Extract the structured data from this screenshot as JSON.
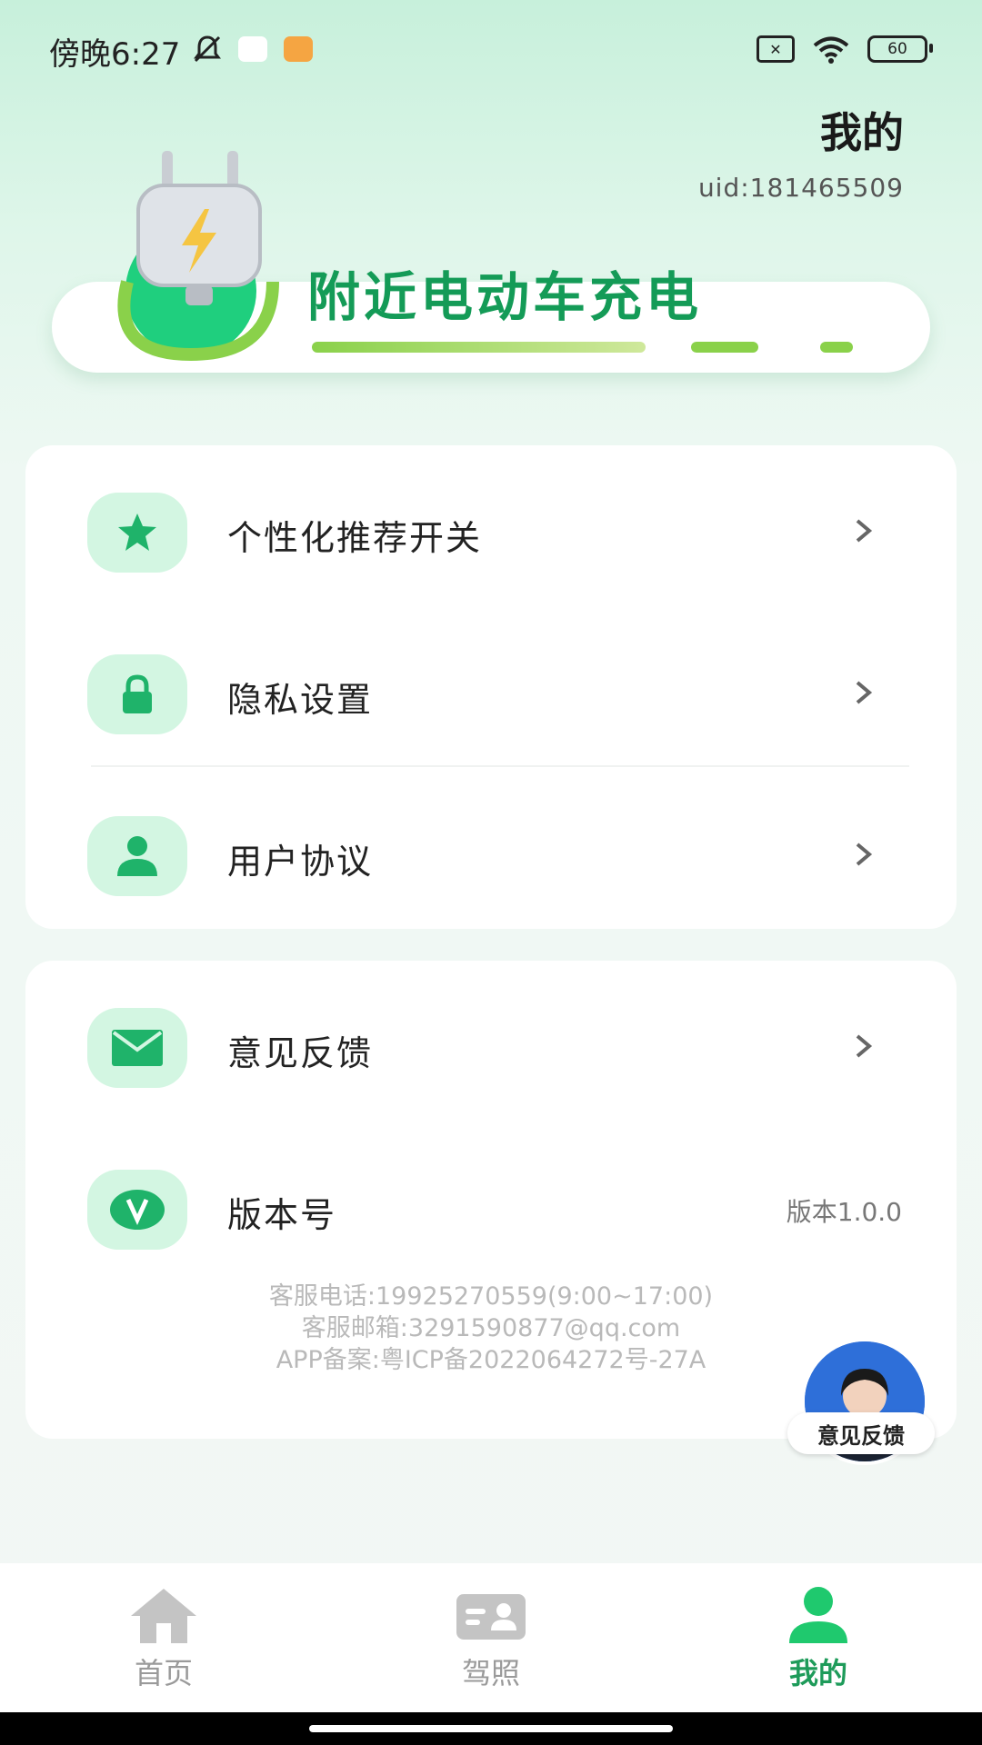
{
  "status_bar": {
    "time": "傍晚6:27",
    "battery": "60"
  },
  "header": {
    "title": "我的",
    "uid": "uid:181465509"
  },
  "banner": {
    "text": "附近电动车充电"
  },
  "menu_card_1": {
    "items": [
      {
        "label": "个性化推荐开关",
        "icon": "star-icon"
      },
      {
        "label": "隐私设置",
        "icon": "lock-icon"
      },
      {
        "label": "用户协议",
        "icon": "user-icon"
      }
    ]
  },
  "menu_card_2": {
    "feedback_label": "意见反馈",
    "version_label": "版本号",
    "version_value": "版本1.0.0"
  },
  "footer_info": {
    "phone": "客服电话:19925270559(9:00~17:00)",
    "email": "客服邮箱:3291590877@qq.com",
    "icp": "APP备案:粤ICP备2022064272号-27A"
  },
  "feedback_float": {
    "label": "意见反馈"
  },
  "bottom_nav": {
    "items": [
      {
        "label": "首页",
        "icon": "home-icon"
      },
      {
        "label": "驾照",
        "icon": "license-icon"
      },
      {
        "label": "我的",
        "icon": "profile-icon"
      }
    ],
    "active_index": 2
  },
  "colors": {
    "accent": "#1e9b5a",
    "icon_bg": "#d3f6e2",
    "icon_fg": "#1fb36a",
    "inactive": "#c4c4c4"
  }
}
